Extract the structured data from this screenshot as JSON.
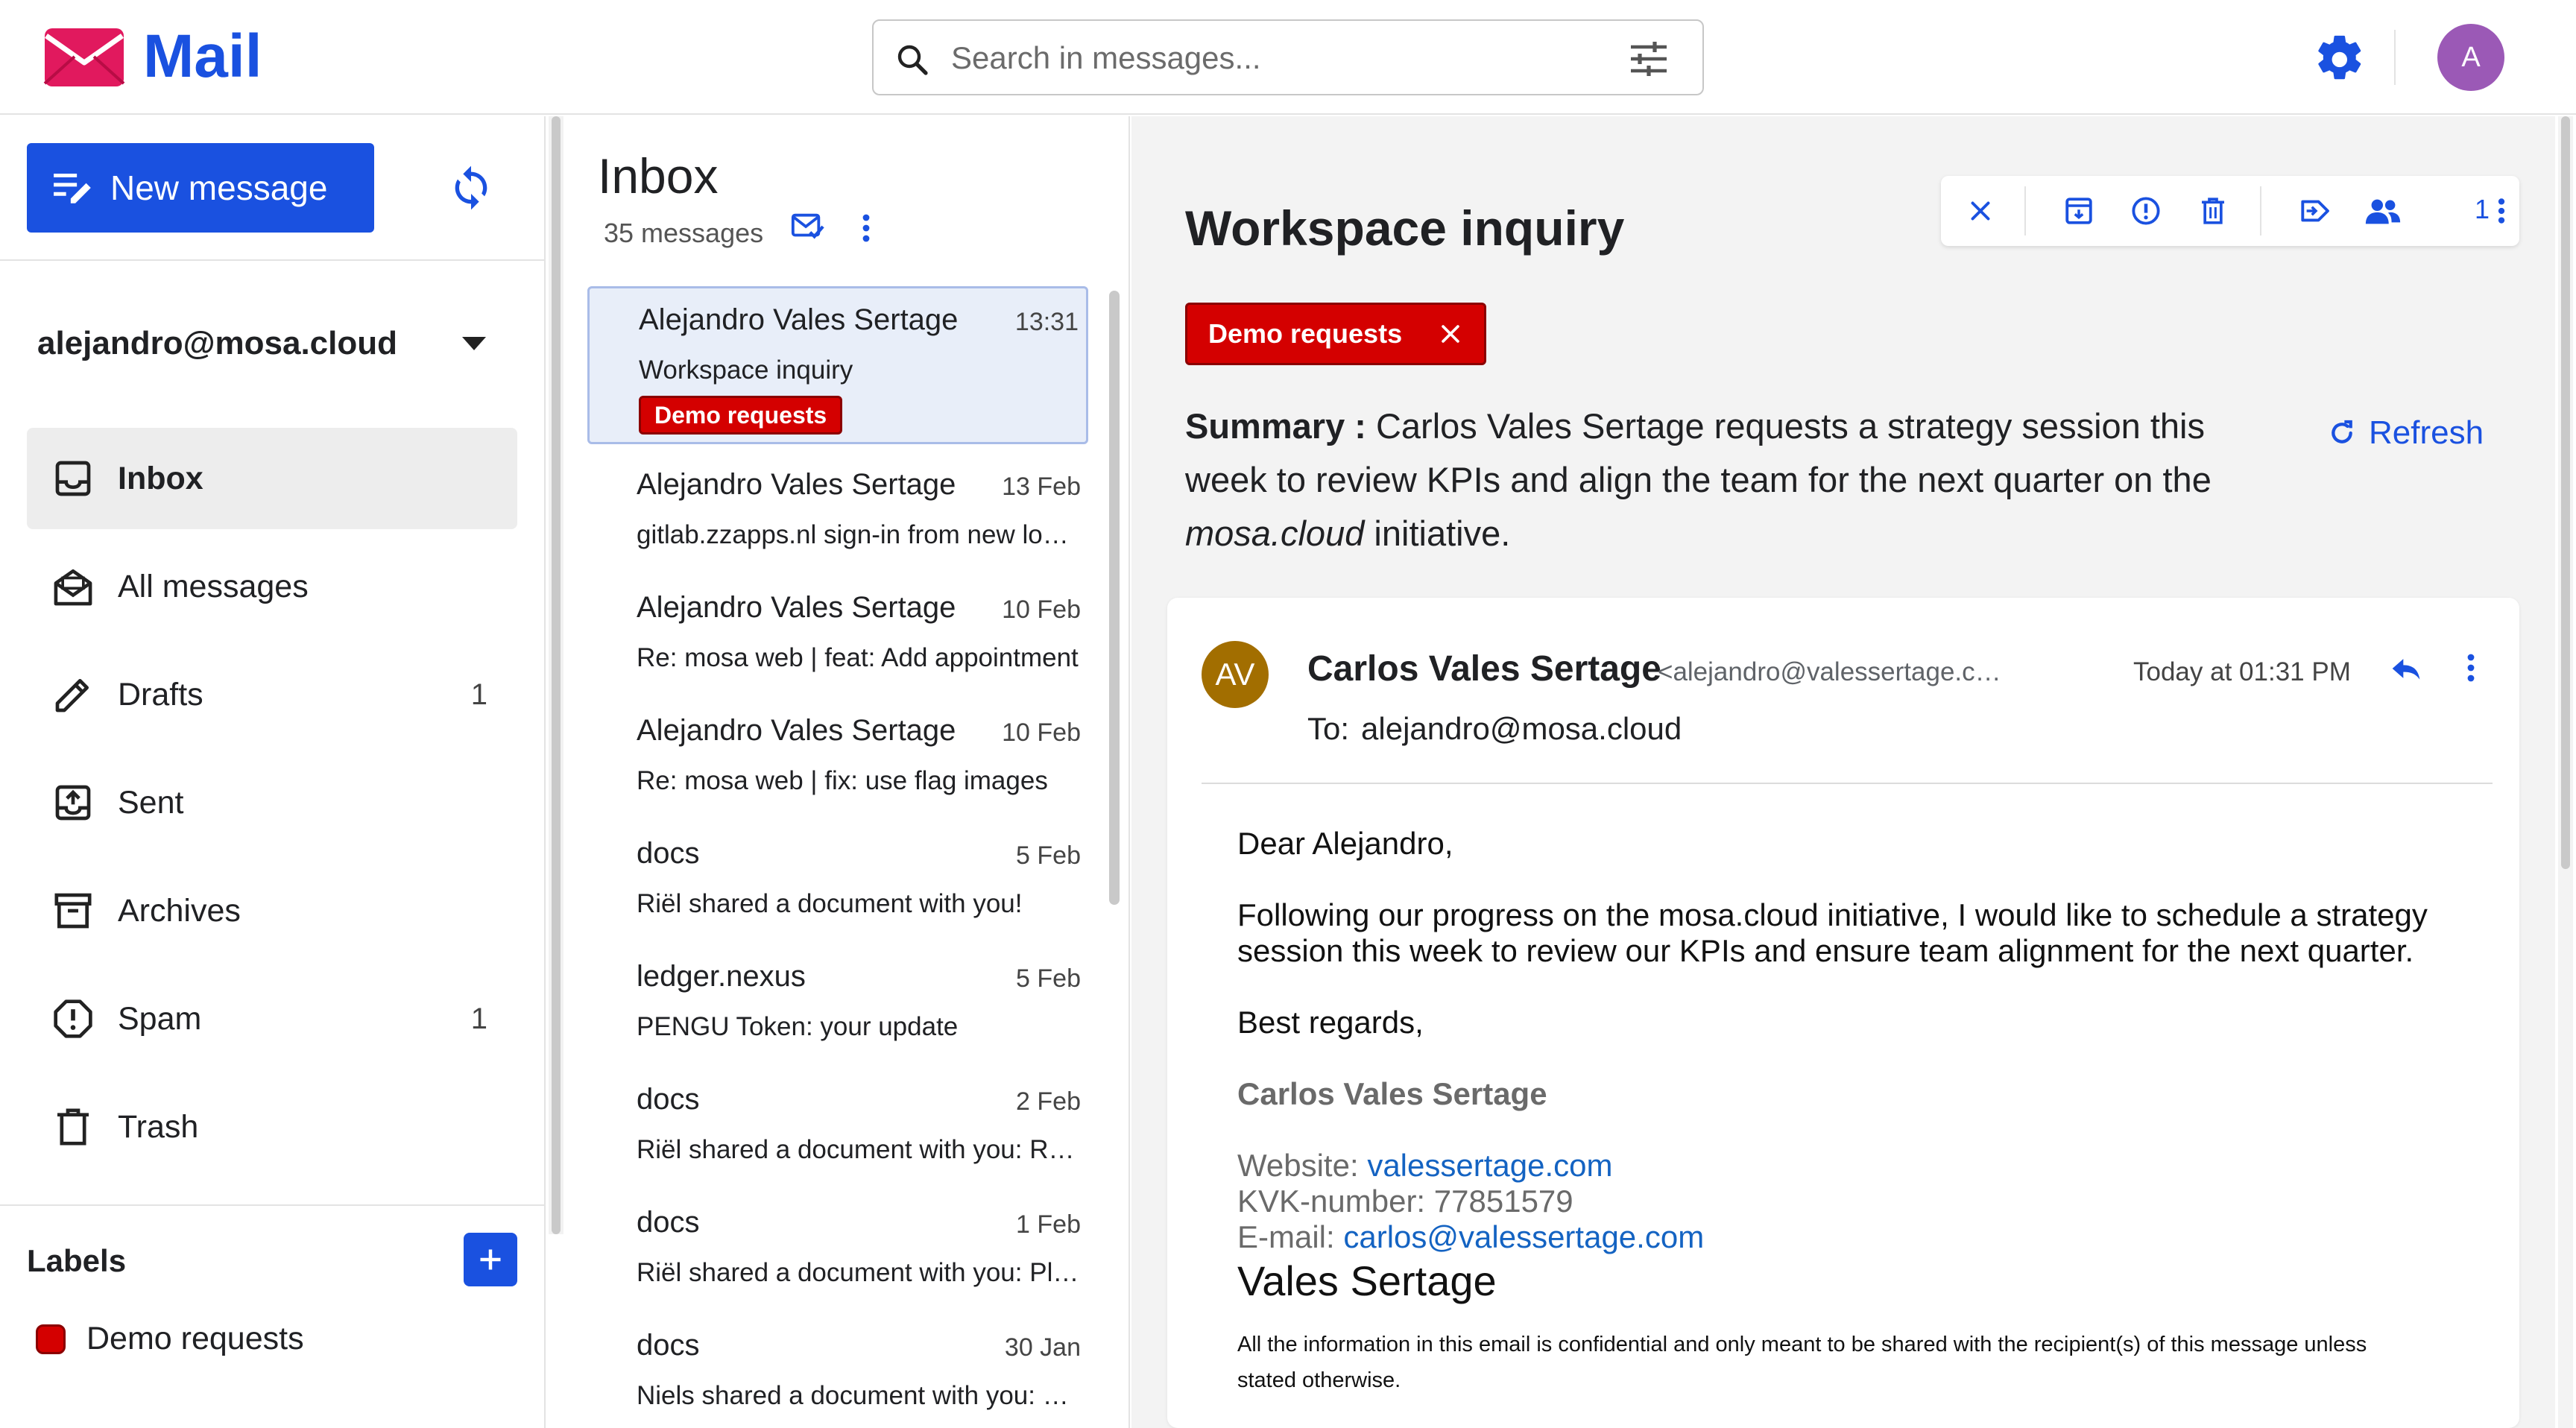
{
  "app": {
    "name": "Mail"
  },
  "search": {
    "placeholder": "Search in messages..."
  },
  "user": {
    "initial": "A"
  },
  "sidebar": {
    "new_message": "New message",
    "account": "alejandro@mosa.cloud",
    "folders": [
      {
        "name": "Inbox",
        "count": "",
        "icon": "inbox-icon",
        "active": true
      },
      {
        "name": "All messages",
        "count": "",
        "icon": "all-messages-icon",
        "active": false
      },
      {
        "name": "Drafts",
        "count": "1",
        "icon": "pencil-icon",
        "active": false
      },
      {
        "name": "Sent",
        "count": "",
        "icon": "sent-icon",
        "active": false
      },
      {
        "name": "Archives",
        "count": "",
        "icon": "archive-icon",
        "active": false
      },
      {
        "name": "Spam",
        "count": "1",
        "icon": "spam-icon",
        "active": false
      },
      {
        "name": "Trash",
        "count": "",
        "icon": "trash-icon",
        "active": false
      }
    ],
    "labels_title": "Labels",
    "labels": [
      {
        "name": "Demo requests",
        "color": "#d40000"
      }
    ]
  },
  "list": {
    "title": "Inbox",
    "count": "35 messages",
    "messages": [
      {
        "sender": "Alejandro Vales Sertage",
        "date": "13:31",
        "subject": "Workspace inquiry",
        "tag": "Demo requests",
        "selected": true
      },
      {
        "sender": "Alejandro Vales Sertage",
        "date": "13 Feb",
        "subject": "gitlab.zzapps.nl sign-in from new location"
      },
      {
        "sender": "Alejandro Vales Sertage",
        "date": "10 Feb",
        "subject": "Re: mosa web | feat: Add appointment"
      },
      {
        "sender": "Alejandro Vales Sertage",
        "date": "10 Feb",
        "subject": "Re: mosa web | fix: use flag images"
      },
      {
        "sender": "docs",
        "date": "5 Feb",
        "subject": "Riël shared a document with you!"
      },
      {
        "sender": "ledger.nexus",
        "date": "5 Feb",
        "subject": "PENGU Token: your update"
      },
      {
        "sender": "docs",
        "date": "2 Feb",
        "subject": "Riël shared a document with you: Roadmap"
      },
      {
        "sender": "docs",
        "date": "1 Feb",
        "subject": "Riël shared a document with you: Planning"
      },
      {
        "sender": "docs",
        "date": "30 Jan",
        "subject": "Niels shared a document with you: Notes"
      }
    ]
  },
  "pane": {
    "title": "Workspace inquiry",
    "tag": "Demo requests",
    "toolbar": {
      "participants_count": "1"
    },
    "summary_label": "Summary :",
    "summary_text_1": " Carlos Vales Sertage requests a strategy session this week to review KPIs and align the team for the next quarter on the ",
    "summary_em": "mosa.cloud",
    "summary_text_2": " initiative.",
    "refresh": "Refresh",
    "message": {
      "avatar": "AV",
      "from_name": "Carlos Vales Sertage",
      "from_email": "<alejandro@valessertage.com>",
      "date": "Today at 01:31 PM",
      "to_label": "To:",
      "to": "alejandro@mosa.cloud",
      "greeting": "Dear Alejandro,",
      "paragraph": "Following our progress on the mosa.cloud initiative, I would like to schedule a strategy session this week to review our KPIs and ensure team alignment for the next quarter.",
      "closing": "Best regards,",
      "signature_name": "Carlos Vales Sertage",
      "website_label": "Website:",
      "website": "valessertage.com",
      "kvk": "KVK-number: 77851579",
      "email_label": "E-mail:",
      "email": "carlos@valessertage.com",
      "company": "Vales Sertage",
      "disclaimer": "All the information in this email is confidential and only meant to be shared with the recipient(s) of this message unless stated otherwise."
    }
  },
  "colors": {
    "brand": "#1a51e0",
    "tag": "#d40000",
    "avatar_user": "#9b59b6",
    "avatar_sender": "#a26e00"
  }
}
